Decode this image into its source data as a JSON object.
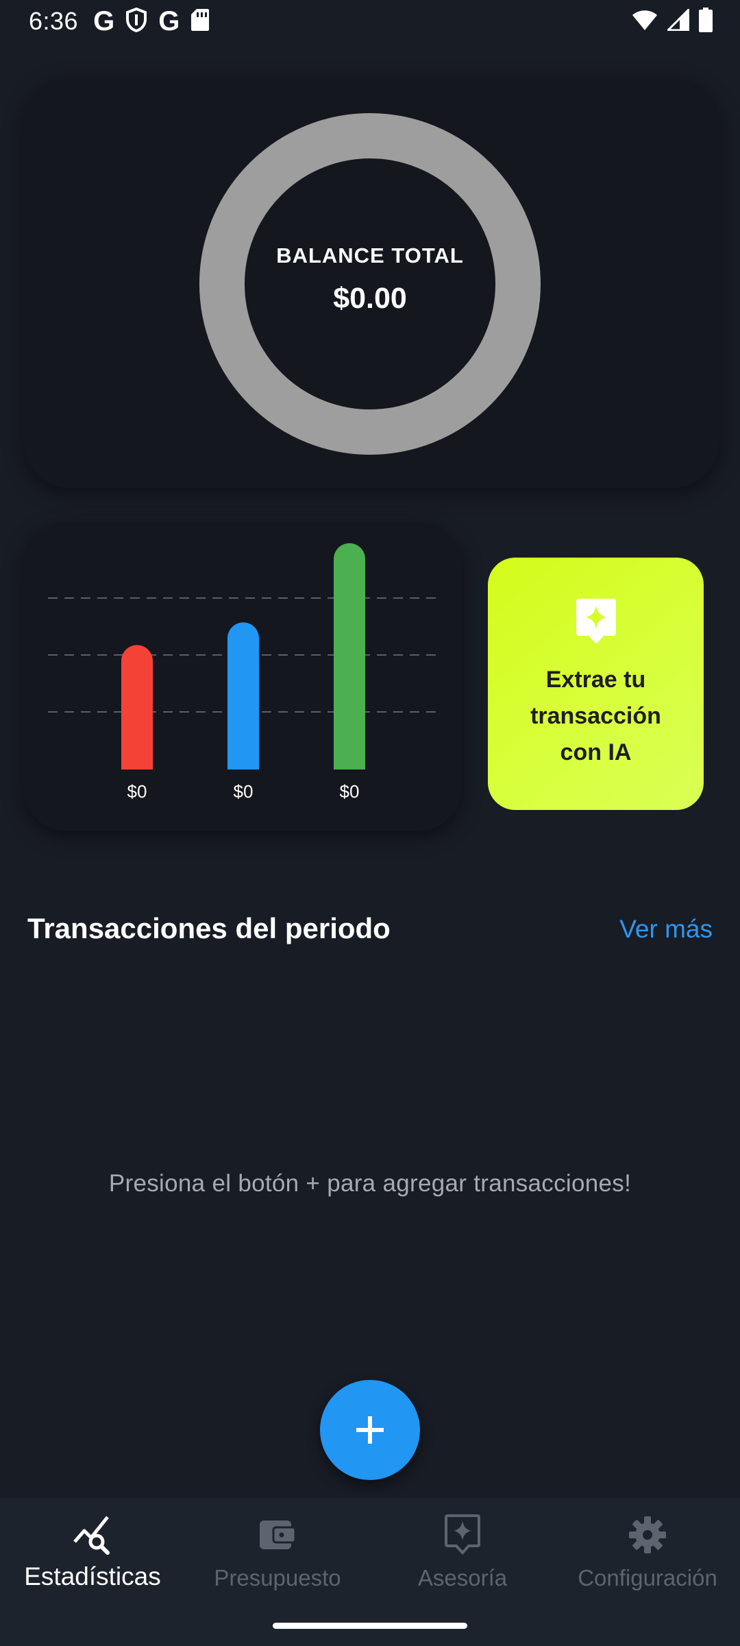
{
  "status_bar": {
    "time": "6:36",
    "notification_icons": [
      "google-g-icon",
      "shield-icon",
      "google-g-icon",
      "sd-card-icon"
    ],
    "g_glyph": "G",
    "system_icons": [
      "wifi-icon",
      "signal-icon",
      "battery-icon"
    ]
  },
  "balance": {
    "label": "BALANCE TOTAL",
    "value": "$0.00",
    "ring_color": "#9e9e9e"
  },
  "chart_data": {
    "type": "bar",
    "categories": [
      "",
      "",
      ""
    ],
    "series": [
      {
        "values": [
          0,
          0,
          0
        ]
      }
    ],
    "bar_heights_relative": [
      0.55,
      0.65,
      1.0
    ],
    "value_labels": [
      "$0",
      "$0",
      "$0"
    ],
    "colors": [
      "#f44336",
      "#2196f3",
      "#4caf50"
    ],
    "grid": true,
    "title": "",
    "xlabel": "",
    "ylabel": ""
  },
  "ai_card": {
    "icon": "sparkle-icon",
    "text": "Extrae tu transacción con IA"
  },
  "transactions": {
    "title": "Transacciones del periodo",
    "see_more": "Ver más",
    "empty_message": "Presiona el botón + para agregar transacciones!"
  },
  "fab": {
    "icon": "plus-icon",
    "color": "#2196f3"
  },
  "bottom_nav": {
    "items": [
      {
        "label": "Estadísticas",
        "icon": "stats-search-icon",
        "active": true
      },
      {
        "label": "Presupuesto",
        "icon": "wallet-icon",
        "active": false
      },
      {
        "label": "Asesoría",
        "icon": "sparkle-icon",
        "active": false
      },
      {
        "label": "Configuración",
        "icon": "gear-icon",
        "active": false
      }
    ]
  }
}
